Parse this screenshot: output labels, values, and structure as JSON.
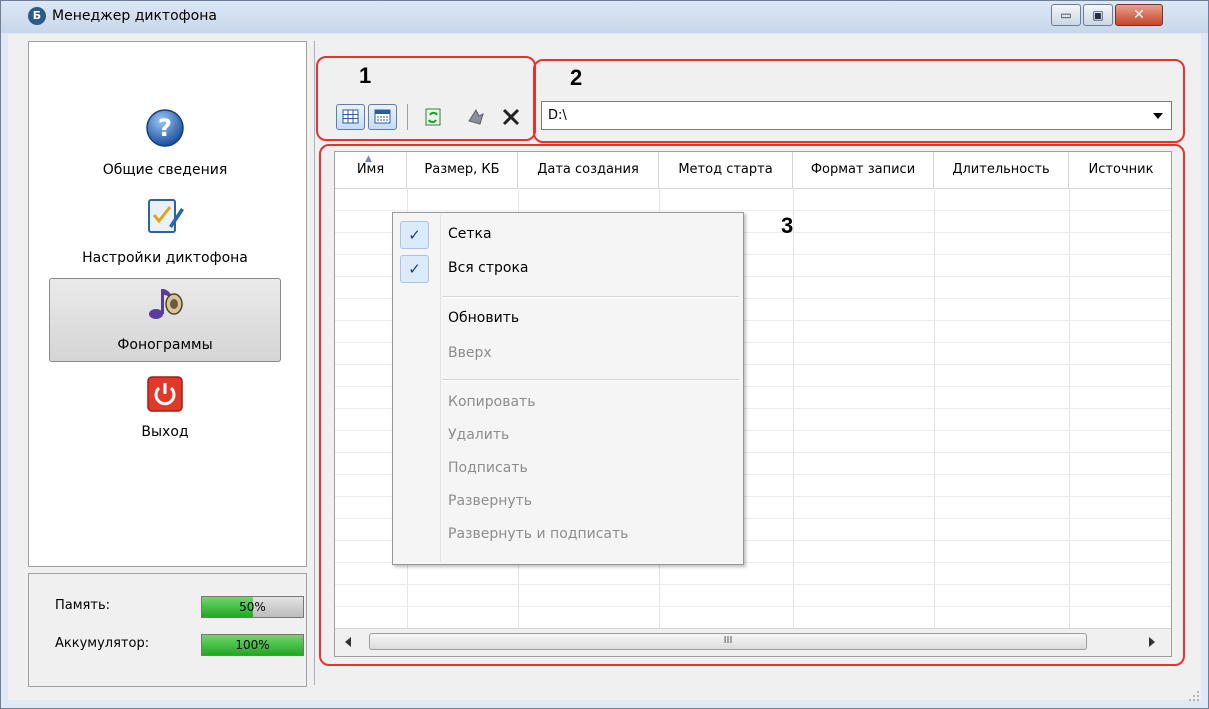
{
  "window": {
    "title": "Менеджер диктофона",
    "icon": "app-logo-icon",
    "controls": {
      "minimize": "▭",
      "maximize": "▣",
      "close": "✕"
    }
  },
  "sidebar": {
    "items": [
      {
        "label": "Общие сведения",
        "icon": "help-icon",
        "selected": false
      },
      {
        "label": "Настройки диктофона",
        "icon": "settings-checklist-icon",
        "selected": false
      },
      {
        "label": "Фонограммы",
        "icon": "music-speaker-icon",
        "selected": true
      },
      {
        "label": "Выход",
        "icon": "power-icon",
        "selected": false
      }
    ]
  },
  "status": {
    "memory": {
      "label": "Память:",
      "value": "50%",
      "fraction": 0.5
    },
    "battery": {
      "label": "Аккумулятор:",
      "value": "100%",
      "fraction": 1.0
    }
  },
  "toolbar": {
    "buttons": [
      "grid-view-icon",
      "details-view-icon",
      "refresh-icon",
      "up-folder-icon",
      "delete-icon"
    ]
  },
  "path": {
    "value": "D:\\"
  },
  "table": {
    "columns": [
      "Имя",
      "Размер, КБ",
      "Дата создания",
      "Метод старта",
      "Формат записи",
      "Длительность",
      "Источник"
    ],
    "scroll_label": "III"
  },
  "context_menu": {
    "items": [
      {
        "label": "Сетка",
        "checked": true,
        "enabled": true
      },
      {
        "label": "Вся строка",
        "checked": true,
        "enabled": true
      },
      {
        "label": "Обновить",
        "checked": false,
        "enabled": true
      },
      {
        "label": "Вверх",
        "checked": false,
        "enabled": false
      },
      {
        "label": "Копировать",
        "checked": false,
        "enabled": false
      },
      {
        "label": "Удалить",
        "checked": false,
        "enabled": false
      },
      {
        "label": "Подписать",
        "checked": false,
        "enabled": false
      },
      {
        "label": "Развернуть",
        "checked": false,
        "enabled": false
      },
      {
        "label": "Развернуть и подписать",
        "checked": false,
        "enabled": false
      }
    ],
    "check_glyph": "✓"
  },
  "callouts": [
    "1",
    "2",
    "3"
  ],
  "colors": {
    "callout": "#e63232",
    "progress": "#2fb92f",
    "accent": "#1c3d7a"
  }
}
